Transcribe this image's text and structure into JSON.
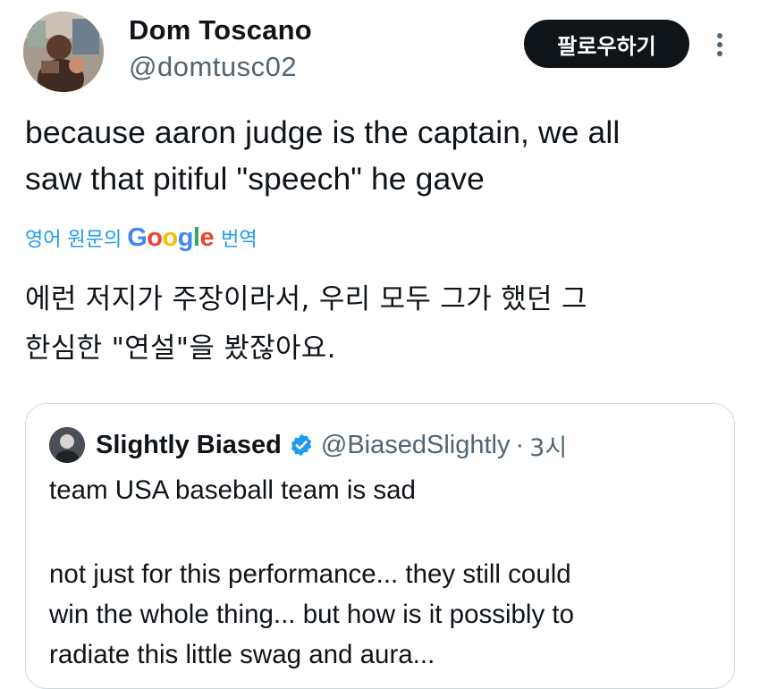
{
  "tweet": {
    "author_name": "Dom Toscano",
    "author_handle": "@domtusc02",
    "follow_label": "팔로우하기",
    "more_icon": "vertical-ellipsis-icon",
    "text_line1": "because aaron judge is the captain, we all",
    "text_line2": "saw that pitiful \"speech\" he gave",
    "translate": {
      "prefix": "영어 원문의",
      "google": "Google",
      "suffix": "번역"
    },
    "translated_line1": "에런 저지가 주장이라서, 우리 모두 그가 했던 그",
    "translated_line2": "한심한 \"연설\"을 봤잖아요."
  },
  "quote": {
    "author_name": "Slightly Biased",
    "author_handle": "@BiasedSlightly",
    "separator": "·",
    "time": "3시",
    "verified_icon": "verified-badge-icon",
    "line1": "team USA baseball team is sad",
    "body_line1": "not just for this performance... they still could",
    "body_line2": "win the whole thing... but how is it possibly to",
    "body_line3": "radiate this little swag and aura..."
  },
  "colors": {
    "text": "#0f1419",
    "secondary": "#536471",
    "link": "#1d9bf0",
    "border": "#cfd9de",
    "button_bg": "#0f1419",
    "verified": "#1d9bf0"
  }
}
